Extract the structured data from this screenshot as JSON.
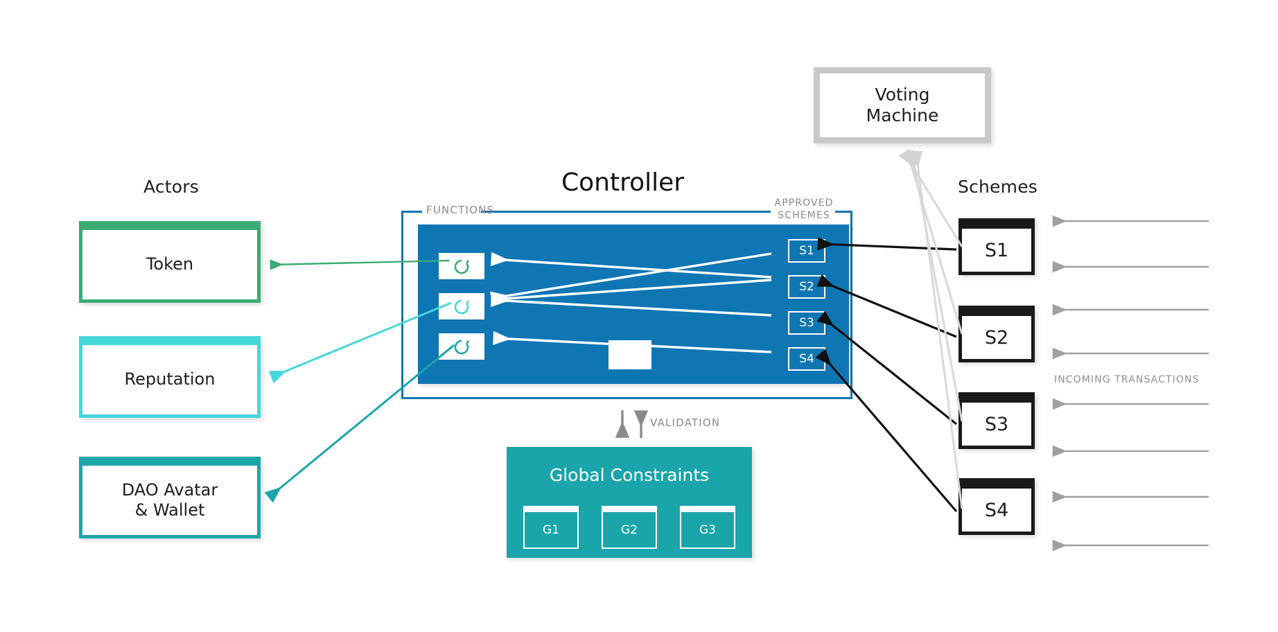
{
  "diagram": {
    "title": "DAO Stack architecture diagram",
    "columns": {
      "actors_heading": "Actors",
      "controller_heading": "Controller",
      "schemes_heading": "Schemes"
    },
    "actors": [
      {
        "label": "Token",
        "color": "#3aab74",
        "icon": "circle-arrow-icon"
      },
      {
        "label": "Reputation",
        "color": "#45d6da",
        "icon": "circle-arrow-icon"
      },
      {
        "label": "DAO Avatar\n& Wallet",
        "line1": "DAO Avatar",
        "line2": "& Wallet",
        "color": "#1aa5ab",
        "icon": "circle-arrow-icon"
      }
    ],
    "controller": {
      "title": "Controller",
      "functions_label": "FUNCTIONS",
      "approved_label_line1": "APPROVED",
      "approved_label_line2": "SCHEMES",
      "panel_color": "#0f76b4",
      "border_color": "#0f76b4",
      "functions": [
        {
          "id": "fn1",
          "circle_color": "#3aab74"
        },
        {
          "id": "fn2",
          "circle_color": "#45d6da"
        },
        {
          "id": "fn3",
          "circle_color": "#1aa5ab"
        }
      ],
      "approved_schemes": [
        {
          "label": "S1"
        },
        {
          "label": "S2"
        },
        {
          "label": "S3"
        },
        {
          "label": "S4"
        }
      ]
    },
    "validation": {
      "label": "VALIDATION",
      "arrow_color": "#8a8a8a"
    },
    "global_constraints": {
      "title": "Global Constraints",
      "color": "#1aa5ab",
      "items": [
        {
          "label": "G1"
        },
        {
          "label": "G2"
        },
        {
          "label": "G3"
        }
      ]
    },
    "voting_machine": {
      "line1": "Voting",
      "line2": "Machine",
      "border_color": "#c9c9c9"
    },
    "schemes": [
      {
        "label": "S1"
      },
      {
        "label": "S2"
      },
      {
        "label": "S3"
      },
      {
        "label": "S4"
      }
    ],
    "incoming": {
      "label": "INCOMING TRANSACTIONS",
      "arrow_color": "#a0a0a0",
      "arrow_count": 6
    }
  },
  "colors": {
    "background": "#ffffff",
    "controller_blue": "#0f76b4",
    "teal": "#1aa5ab",
    "cyan": "#45d6da",
    "green": "#3aab74",
    "black": "#1a1a1a",
    "gray_light": "#c9c9c9",
    "gray_mid": "#a0a0a0",
    "label_gray": "#8a8a8a"
  }
}
